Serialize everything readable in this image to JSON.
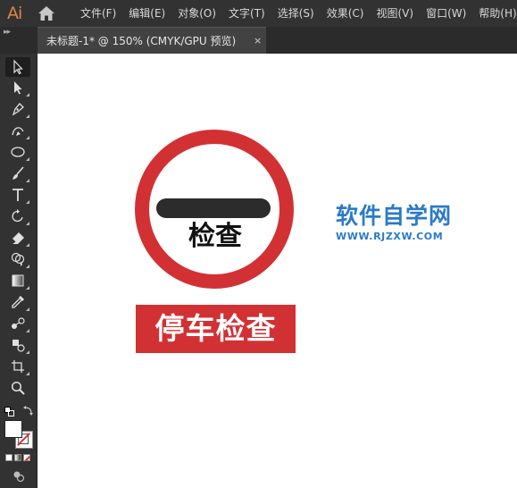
{
  "app": {
    "logo": "Ai"
  },
  "menu": [
    "文件(F)",
    "编辑(E)",
    "对象(O)",
    "文字(T)",
    "选择(S)",
    "效果(C)",
    "视图(V)",
    "窗口(W)",
    "帮助(H)"
  ],
  "tab": {
    "title": "未标题-1* @ 150% (CMYK/GPU 预览)",
    "close": "×"
  },
  "tools": [
    "selection-tool",
    "direct-selection-tool",
    "pen-tool",
    "curvature-tool",
    "ellipse-tool",
    "paintbrush-tool",
    "type-tool",
    "rotate-tool",
    "eraser-tool",
    "shape-builder-tool",
    "gradient-tool",
    "eyedropper-tool",
    "blend-tool",
    "symbol-sprayer-tool",
    "artboard-tool",
    "zoom-tool"
  ],
  "artwork": {
    "sign_label": "检查",
    "banner_text": "停车检查",
    "colors": {
      "red": "#d23134",
      "bar": "#2c2c2c",
      "watermark": "#2b7ac8"
    }
  },
  "watermark": {
    "title": "软件自学网",
    "url": "WWW.RJZXW.COM"
  }
}
